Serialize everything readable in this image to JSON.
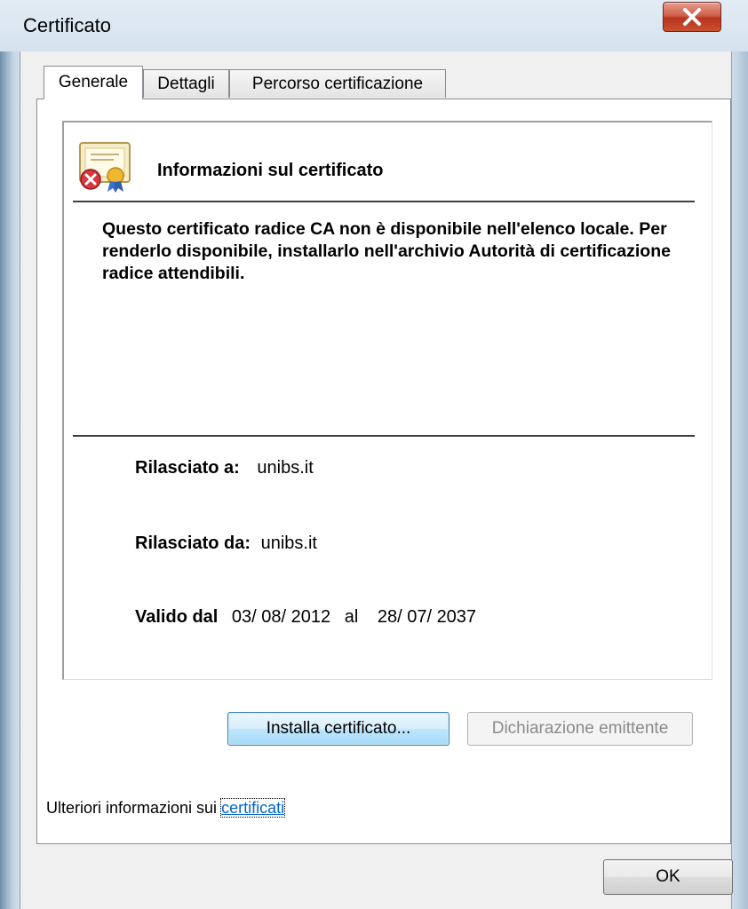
{
  "window": {
    "title": "Certificato",
    "close_label": "X"
  },
  "tabs": [
    {
      "label": "Generale",
      "active": true
    },
    {
      "label": "Dettagli",
      "active": false
    },
    {
      "label": "Percorso certificazione",
      "active": false
    }
  ],
  "certificate": {
    "icon": "certificate-error-icon",
    "heading": "Informazioni sul certificato",
    "message": "Questo certificato radice CA non è disponibile nell'elenco locale. Per renderlo disponibile, installarlo nell'archivio Autorità di certificazione radice attendibili.",
    "issued_to_label": "Rilasciato a:",
    "issued_to_value": "unibs.it",
    "issued_by_label": "Rilasciato da:",
    "issued_by_value": "unibs.it",
    "valid_from_label": "Valido dal",
    "valid_from_value": "03/ 08/ 2012",
    "valid_to_label": "al",
    "valid_to_value": "28/ 07/ 2037"
  },
  "buttons": {
    "install": "Installa certificato...",
    "issuer_statement": "Dichiarazione emittente",
    "ok": "OK"
  },
  "footer": {
    "more_info_text": "Ulteriori informazioni sui",
    "more_info_link": "certificati"
  },
  "colors": {
    "link": "#0066cc",
    "close_button": "#c9502f",
    "primary_button_border": "#3c7fb1"
  }
}
